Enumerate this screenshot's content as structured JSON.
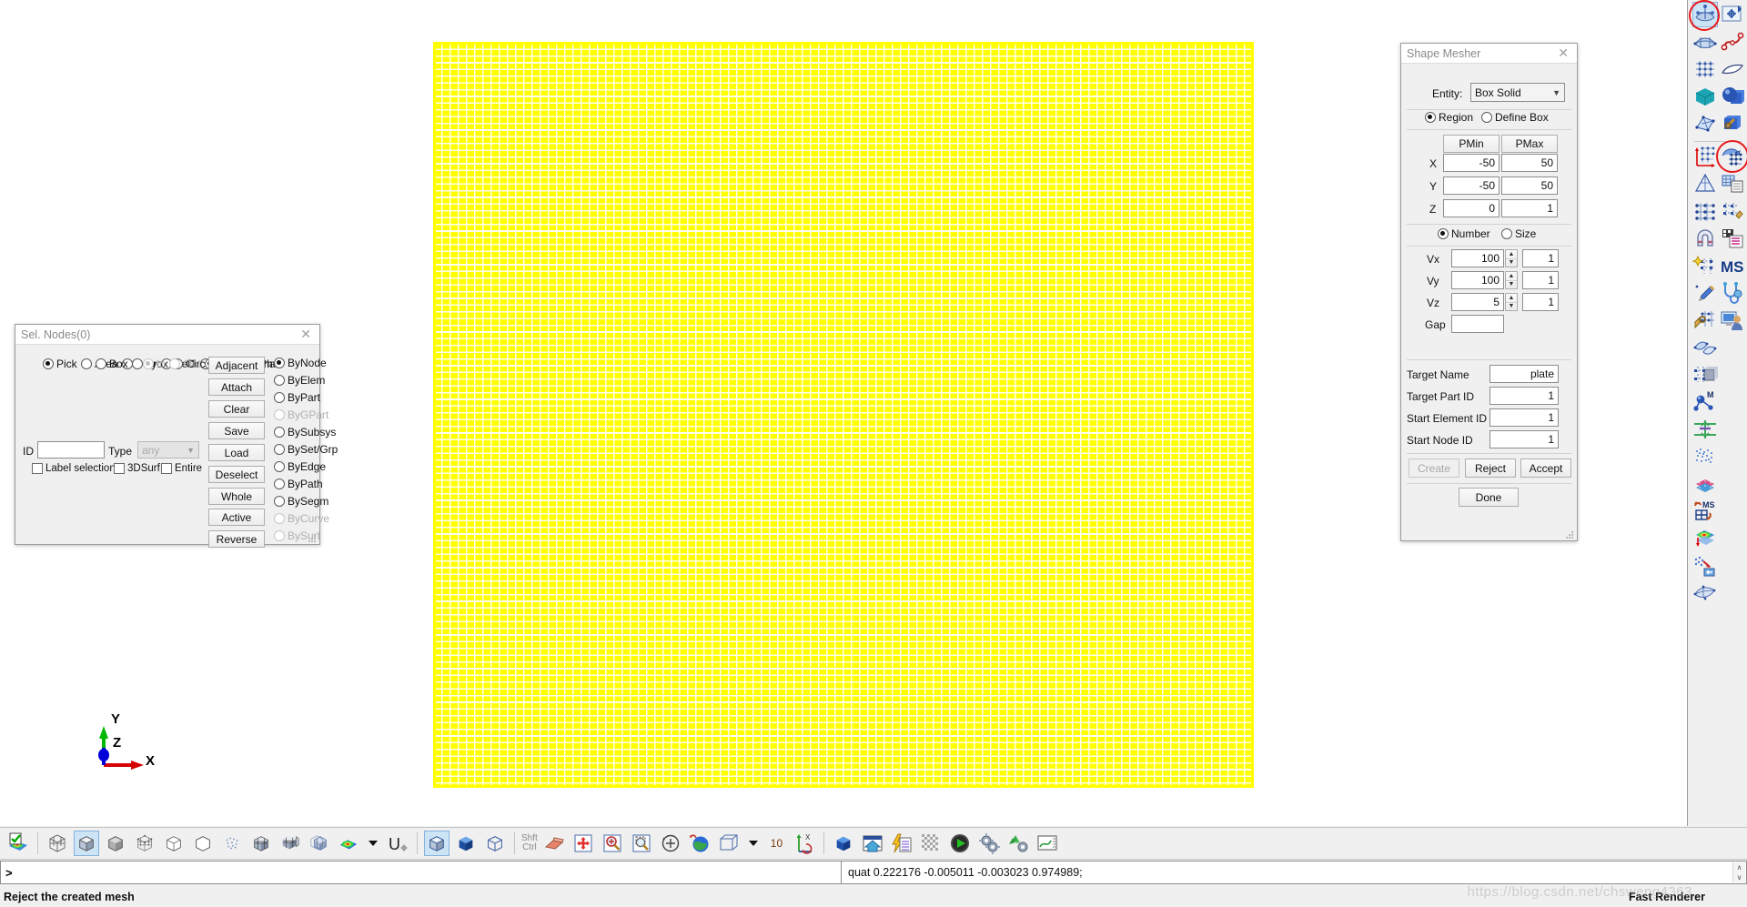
{
  "viewport": {
    "mesh_color": "#ffff00",
    "grid_color": "#ffffff",
    "triad": {
      "x_label": "X",
      "y_label": "Y",
      "z_label": "Z",
      "x_color": "#d60000",
      "y_color": "#00b800",
      "z_color": "#0000d8"
    }
  },
  "sel_nodes": {
    "title": "Sel. Nodes(0)",
    "close": "✕",
    "mode_col1": [
      {
        "label": "Pick",
        "selected": true,
        "enabled": true
      },
      {
        "label": "Area",
        "selected": false,
        "enabled": true
      },
      {
        "label": "Poly",
        "selected": false,
        "enabled": true
      },
      {
        "label": "Sel1",
        "selected": false,
        "enabled": true
      },
      {
        "label": "Sphe",
        "selected": false,
        "enabled": true
      }
    ],
    "mode_col2": [
      {
        "label": "Box",
        "selected": false,
        "enabled": true
      },
      {
        "label": "Prox",
        "selected": false,
        "enabled": true
      },
      {
        "label": "Circ",
        "selected": false,
        "enabled": true
      },
      {
        "label": "Frin",
        "selected": false,
        "enabled": true
      },
      {
        "label": "Plan",
        "selected": false,
        "enabled": true
      }
    ],
    "mode_col3": [
      {
        "label": "In",
        "selected": true,
        "enabled": false
      },
      {
        "label": "Out",
        "selected": false,
        "enabled": false
      },
      {
        "label": "Add",
        "selected": true,
        "enabled": true
      },
      {
        "label": "Rm",
        "selected": false,
        "enabled": true
      }
    ],
    "id_label": "ID",
    "id_value": "",
    "type_label": "Type",
    "type_value": "any",
    "type_enabled": false,
    "checkboxes": [
      {
        "label": "Label selection",
        "checked": false
      },
      {
        "label": "3DSurf",
        "checked": false
      },
      {
        "label": "Entire",
        "checked": false
      }
    ],
    "buttons": [
      {
        "label": "Adjacent",
        "enabled": true
      },
      {
        "label": "Attach",
        "enabled": true
      },
      {
        "label": "Clear",
        "enabled": true
      },
      {
        "label": "Save",
        "enabled": true
      },
      {
        "label": "Load",
        "enabled": true
      },
      {
        "label": "Deselect",
        "enabled": true
      },
      {
        "label": "Whole",
        "enabled": true
      },
      {
        "label": "Active",
        "enabled": true
      },
      {
        "label": "Reverse",
        "enabled": true
      }
    ],
    "by_options": [
      {
        "label": "ByNode",
        "selected": true,
        "enabled": true
      },
      {
        "label": "ByElem",
        "selected": false,
        "enabled": true
      },
      {
        "label": "ByPart",
        "selected": false,
        "enabled": true
      },
      {
        "label": "ByGPart",
        "selected": false,
        "enabled": false
      },
      {
        "label": "BySubsys",
        "selected": false,
        "enabled": true
      },
      {
        "label": "BySet/Grp",
        "selected": false,
        "enabled": true
      },
      {
        "label": "ByEdge",
        "selected": false,
        "enabled": true
      },
      {
        "label": "ByPath",
        "selected": false,
        "enabled": true
      },
      {
        "label": "BySegm",
        "selected": false,
        "enabled": true
      },
      {
        "label": "ByCurve",
        "selected": false,
        "enabled": false
      },
      {
        "label": "BySurf",
        "selected": false,
        "enabled": false
      }
    ]
  },
  "shape_mesher": {
    "title": "Shape Mesher",
    "close": "✕",
    "entity_label": "Entity:",
    "entity_value": "Box Solid",
    "region_radio": {
      "label": "Region",
      "selected": true
    },
    "define_box_radio": {
      "label": "Define Box",
      "selected": false
    },
    "col_pmin": "PMin",
    "col_pmax": "PMax",
    "rows": [
      {
        "axis": "X",
        "pmin": "-50",
        "pmax": "50"
      },
      {
        "axis": "Y",
        "pmin": "-50",
        "pmax": "50"
      },
      {
        "axis": "Z",
        "pmin": "0",
        "pmax": "1"
      }
    ],
    "number_radio": {
      "label": "Number",
      "selected": true
    },
    "size_radio": {
      "label": "Size",
      "selected": false
    },
    "divisions": [
      {
        "axis": "Vx",
        "count": "100",
        "bias": "1"
      },
      {
        "axis": "Vy",
        "count": "100",
        "bias": "1"
      },
      {
        "axis": "Vz",
        "count": "5",
        "bias": "1"
      }
    ],
    "gap_label": "Gap",
    "gap_value": "",
    "fields": [
      {
        "label": "Target Name",
        "value": "plate"
      },
      {
        "label": "Target Part ID",
        "value": "1"
      },
      {
        "label": "Start Element ID",
        "value": "1"
      },
      {
        "label": "Start Node ID",
        "value": "1"
      }
    ],
    "create_button": {
      "label": "Create",
      "enabled": false
    },
    "reject_button": {
      "label": "Reject",
      "enabled": true
    },
    "accept_button": {
      "label": "Accept",
      "enabled": true
    },
    "done_button": {
      "label": "Done",
      "enabled": true
    }
  },
  "right_rail": {
    "highlight_color": "#e8191c",
    "icons": [
      "mesh-surface-icon",
      "move-plane-icon",
      "mesh-shell-icon",
      "curve-nodes-icon",
      "mesh-grid-icon",
      "flat-surface-icon",
      "solid-block-icon",
      "sphere-solid-icon",
      "mesh-patch-icon",
      "extrude-solid-icon",
      "mesh-axes-icon",
      "shape-mesher-icon",
      "pyramid-mesh-icon",
      "table-mesh-icon",
      "lattice-icon",
      "node-edit-icon",
      "magnet-icon",
      "script-list-icon",
      "sparkle-nodes-icon",
      "ms-label-icon",
      "pencil-icon",
      "stethoscope-icon",
      "node-wrench-icon",
      "monitor-user-icon",
      "shell-pair-icon",
      "solid-nodes-icon",
      "morph-m-icon",
      "midplane-icon",
      "point-cloud-icon",
      "layered-block-icon",
      "ms-node-icon",
      "contour-plane-icon",
      "scatter-import-icon",
      "surface-patch-icon"
    ]
  },
  "bottom_toolbar": {
    "shift_label": "Shft",
    "ctrl_label": "Ctrl",
    "number_value": "10",
    "icons": [
      "contour-check-icon",
      "wireframe-cube-icon",
      "shaded-cube-icon",
      "grey-cube-icon",
      "mesh-cube-icon",
      "hidden-line-cube-icon",
      "outline-cube-icon",
      "dotted-cube-icon",
      "split-cube-icon",
      "exploded-cube-icon",
      "transparent-cube-icon",
      "contour-blob-icon",
      "dropdown-caret-icon",
      "u-symbol-icon",
      "clip-cube-icon",
      "iso-cube-icon",
      "shaded-dark-cube-icon",
      "wire-cube-icon",
      "eraser-icon",
      "pan-icon",
      "zoom-in-icon",
      "zoom-window-icon",
      "rotate-icon",
      "globe-icon",
      "bounding-box-icon",
      "view-caret-icon",
      "axis-rotate-icon",
      "blue-cube-icon",
      "home-view-icon",
      "quick-script-icon",
      "checker-icon",
      "play-icon",
      "gears-icon",
      "recycle-gear-icon",
      "plot-icon"
    ]
  },
  "command_line": {
    "prompt": ">",
    "input_value": "",
    "right_value": "quat 0.222176 -0.005011 -0.003023 0.974989;",
    "scroll_up": "∧",
    "scroll_down": "∨"
  },
  "status_bar": {
    "message": "Reject the created mesh",
    "renderer": "Fast Renderer"
  },
  "watermark": "https://blog.csdn.net/chsweng4363"
}
